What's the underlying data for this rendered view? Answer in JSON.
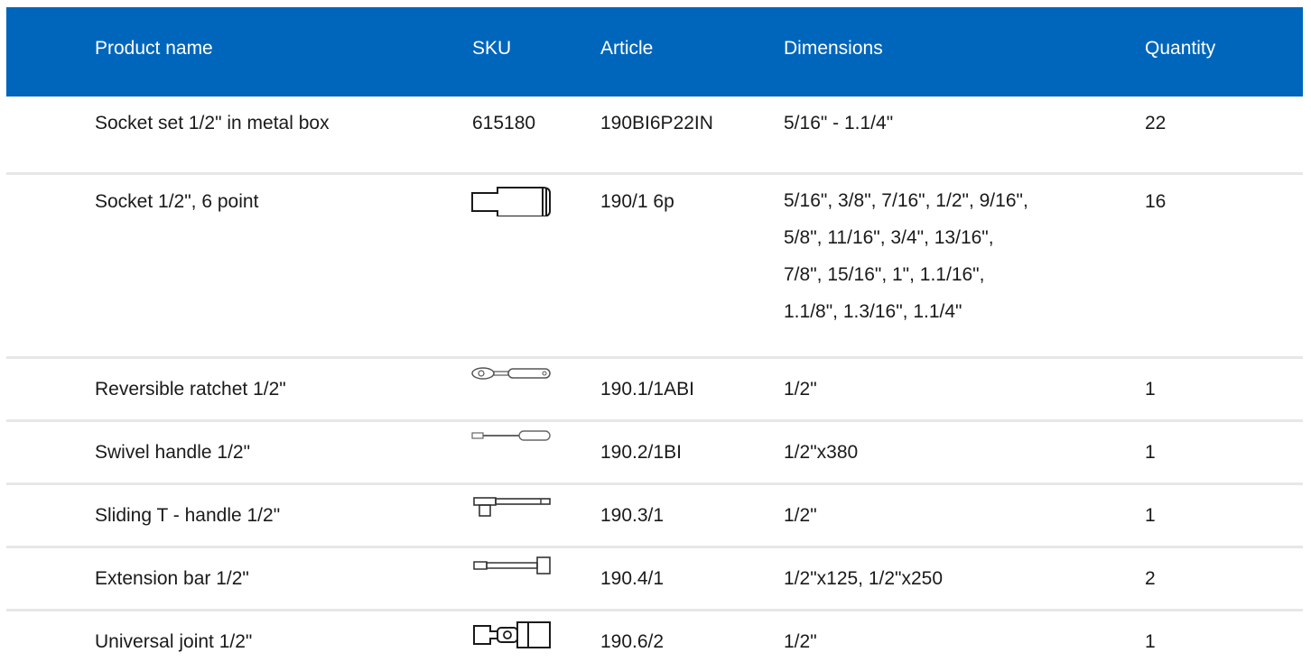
{
  "header": {
    "product_name": "Product name",
    "sku": "SKU",
    "article": "Article",
    "dimensions": "Dimensions",
    "quantity": "Quantity"
  },
  "rows": [
    {
      "name": "Socket set 1/2\" in metal box",
      "sku": "615180",
      "icon": "",
      "article": "190BI6P22IN",
      "dimensions": [
        "5/16\" - 1.1/4\""
      ],
      "quantity": "22"
    },
    {
      "name": "Socket 1/2\", 6 point",
      "sku": "",
      "icon": "socket-icon",
      "article": "190/1 6p",
      "dimensions": [
        "5/16\", 3/8\", 7/16\", 1/2\", 9/16\",",
        "5/8\", 11/16\", 3/4\", 13/16\",",
        "7/8\", 15/16\", 1\", 1.1/16\",",
        "1.1/8\", 1.3/16\", 1.1/4\""
      ],
      "quantity": "16"
    },
    {
      "name": "Reversible ratchet 1/2\"",
      "sku": "",
      "icon": "ratchet-icon",
      "article": "190.1/1ABI",
      "dimensions": [
        "1/2\""
      ],
      "quantity": "1"
    },
    {
      "name": "Swivel handle 1/2\"",
      "sku": "",
      "icon": "swivel-handle-icon",
      "article": "190.2/1BI",
      "dimensions": [
        "1/2\"x380"
      ],
      "quantity": "1"
    },
    {
      "name": "Sliding T - handle 1/2\"",
      "sku": "",
      "icon": "t-handle-icon",
      "article": "190.3/1",
      "dimensions": [
        "1/2\""
      ],
      "quantity": "1"
    },
    {
      "name": "Extension bar 1/2\"",
      "sku": "",
      "icon": "extension-bar-icon",
      "article": "190.4/1",
      "dimensions": [
        "1/2\"x125, 1/2\"x250"
      ],
      "quantity": "2"
    },
    {
      "name": "Universal joint 1/2\"",
      "sku": "",
      "icon": "universal-joint-icon",
      "article": "190.6/2",
      "dimensions": [
        "1/2\""
      ],
      "quantity": "1"
    }
  ]
}
